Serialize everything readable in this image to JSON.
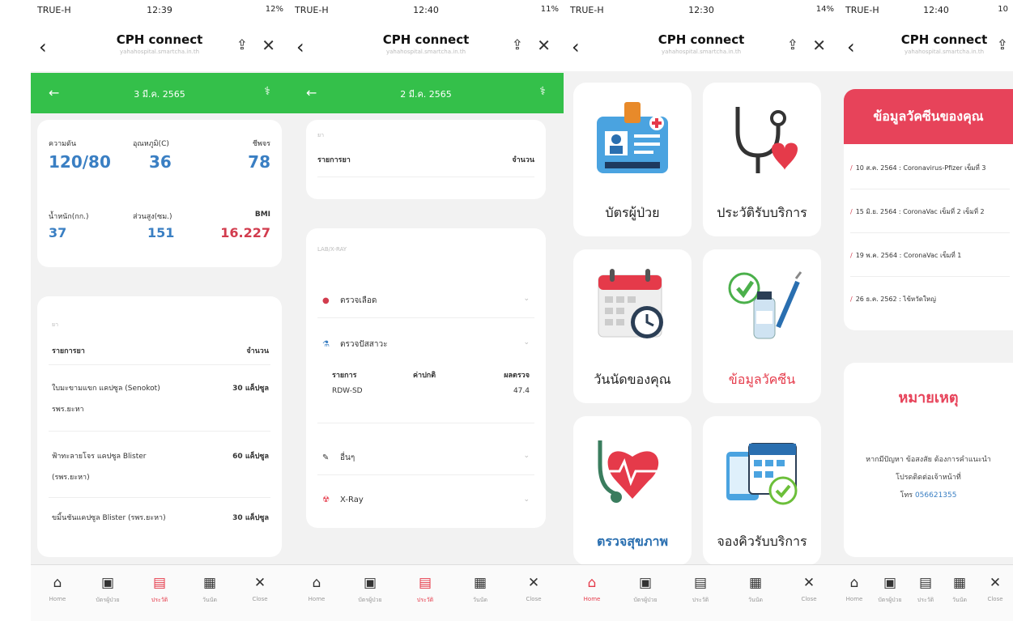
{
  "status": [
    {
      "carrier": "TRUE-H",
      "time": "12:39",
      "battery": "12%"
    },
    {
      "carrier": "TRUE-H",
      "time": "12:40",
      "battery": "11%"
    },
    {
      "carrier": "TRUE-H",
      "time": "12:30",
      "battery": "14%"
    },
    {
      "carrier": "TRUE-H",
      "time": "12:40",
      "battery": "10"
    }
  ],
  "browser": {
    "title": "CPH connect",
    "url": "yahahospital.smartcha.in.th"
  },
  "screen1": {
    "date": "3 มี.ค. 2565",
    "vitals": {
      "bp_label": "ความดัน",
      "bp_value": "120/80",
      "temp_label": "อุณหภูมิ(C)",
      "temp_value": "36",
      "pulse_label": "ชีพจร",
      "pulse_value": "78",
      "weight_label": "น้ำหนัก(กก.)",
      "weight_value": "37",
      "height_label": "ส่วนสูง(ซม.)",
      "height_value": "151",
      "bmi_label": "BMI",
      "bmi_value": "16.227"
    },
    "meds": {
      "caption": "ยา",
      "col_item": "รายการยา",
      "col_qty": "จำนวน",
      "items": [
        {
          "name": "ใบมะขามแขก แคปซูล (Senokot)",
          "sub": "รพร.ยะหา",
          "qty": "30 แค็ปซูล"
        },
        {
          "name": "ฟ้าทะลายโจร แคปซูล Blister",
          "sub": "(รพร.ยะหา)",
          "qty": "60 แค็ปซูล"
        },
        {
          "name": "ขมิ้นชันแคปซูล Blister (รพร.ยะหา)",
          "sub": "",
          "qty": "30 แค็ปซูล"
        }
      ]
    }
  },
  "screen2": {
    "date": "2 มี.ค. 2565",
    "meds": {
      "caption": "ยา",
      "col_item": "รายการยา",
      "col_qty": "จำนวน"
    },
    "lab": {
      "caption": "LAB/X-RAY",
      "blood": "ตรวจเลือด",
      "urine": "ตรวจปัสสาวะ",
      "table_headers": [
        "รายการ",
        "ค่าปกติ",
        "ผลตรวจ"
      ],
      "table_row": {
        "item": "RDW-SD",
        "normal": "",
        "result": "47.4"
      },
      "other": "อื่นๆ",
      "xray": "X-Ray"
    }
  },
  "screen3": {
    "tiles": [
      {
        "label": "บัตรผู้ป่วย",
        "icon": "patient-card-icon",
        "color": "#222222"
      },
      {
        "label": "ประวัติรับบริการ",
        "icon": "stethoscope-heart-icon",
        "color": "#222222"
      },
      {
        "label": "วันนัดของคุณ",
        "icon": "calendar-clock-icon",
        "color": "#222222"
      },
      {
        "label": "ข้อมูลวัคซีน",
        "icon": "vaccine-icon",
        "color": "#e53a4a"
      },
      {
        "label": "ตรวจสุขภาพ",
        "icon": "stethoscope-heart-icon",
        "color": "#2a6fb0"
      },
      {
        "label": "จองคิวรับบริการ",
        "icon": "booking-calendar-icon",
        "color": "#222222"
      }
    ]
  },
  "screen4": {
    "vaccine_title": "ข้อมูลวัคซีนของคุณ",
    "vaccines": [
      "10 ส.ค. 2564 : Coronavirus-Pfizer เข็มที่ 3",
      "15 มิ.ย. 2564 : CoronaVac เข็มที่ 2 เข็มที่ 2",
      "19 พ.ค. 2564 : CoronaVac เข็มที่ 1",
      "26 ธ.ค. 2562 : ไข้หวัดใหญ่"
    ],
    "note_title": "หมายเหตุ",
    "note_line1": "หากมีปัญหา ข้อสงสัย ต้องการคำแนะนำ",
    "note_line2": "โปรดติดต่อเจ้าหน้าที่",
    "note_line3_prefix": "โทร ",
    "note_phone": "056621355"
  },
  "nav": [
    {
      "label": "Home",
      "icon": "home-icon"
    },
    {
      "label": "บัตรผู้ป่วย",
      "icon": "card-icon"
    },
    {
      "label": "ประวัติ",
      "icon": "history-icon"
    },
    {
      "label": "วันนัด",
      "icon": "calendar-icon"
    },
    {
      "label": "Close",
      "icon": "close-icon"
    }
  ],
  "colors": {
    "green": "#34c04a",
    "red": "#e7435a",
    "blue": "#3a7fc3"
  }
}
